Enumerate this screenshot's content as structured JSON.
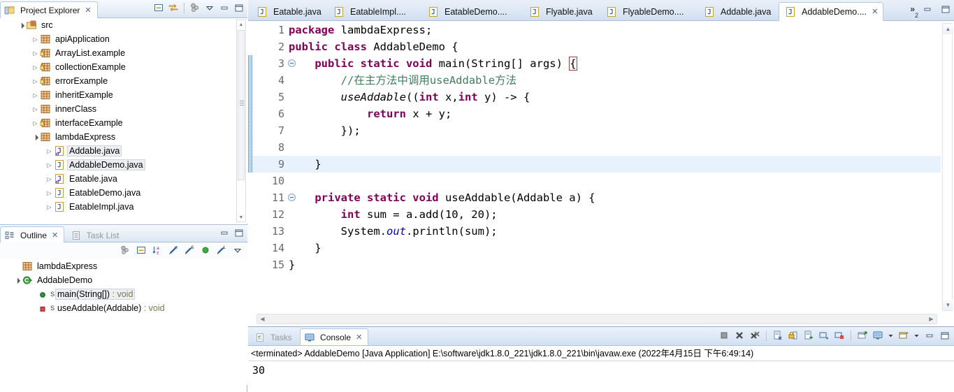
{
  "project_explorer": {
    "tab_label": "Project Explorer",
    "close_glyph": "✕",
    "toolbar": [
      {
        "name": "collapse-all-icon",
        "title": "Collapse All"
      },
      {
        "name": "link-with-editor-icon",
        "title": "Link with Editor"
      },
      {
        "name": "view-menu-spheres-icon",
        "title": "Focus on Active Task"
      },
      {
        "name": "view-menu-chevron-icon",
        "title": "View Menu"
      },
      {
        "name": "minimize-icon",
        "title": "Minimize"
      },
      {
        "name": "maximize-icon",
        "title": "Maximize"
      }
    ],
    "tree": [
      {
        "label": "src",
        "depth": 0,
        "icon": "source-folder-icon",
        "arrow": "down",
        "selected": false
      },
      {
        "label": "apiApplication",
        "depth": 1,
        "icon": "package-icon",
        "arrow": "right",
        "selected": false
      },
      {
        "label": "ArrayList.example",
        "depth": 1,
        "icon": "package-warn-icon",
        "arrow": "right",
        "selected": false
      },
      {
        "label": "collectionExample",
        "depth": 1,
        "icon": "package-warn-icon",
        "arrow": "right",
        "selected": false
      },
      {
        "label": "errorExample",
        "depth": 1,
        "icon": "package-warn-icon",
        "arrow": "right",
        "selected": false
      },
      {
        "label": "inheritExample",
        "depth": 1,
        "icon": "package-icon",
        "arrow": "right",
        "selected": false
      },
      {
        "label": "innerClass",
        "depth": 1,
        "icon": "package-icon",
        "arrow": "right",
        "selected": false
      },
      {
        "label": "interfaceExample",
        "depth": 1,
        "icon": "package-warn-icon",
        "arrow": "right",
        "selected": false
      },
      {
        "label": "lambdaExpress",
        "depth": 1,
        "icon": "package-icon",
        "arrow": "down",
        "selected": false
      },
      {
        "label": "Addable.java",
        "depth": 2,
        "icon": "java-interface-icon",
        "arrow": "right",
        "selected": true
      },
      {
        "label": "AddableDemo.java",
        "depth": 2,
        "icon": "java-class-icon",
        "arrow": "right",
        "selected": true
      },
      {
        "label": "Eatable.java",
        "depth": 2,
        "icon": "java-interface-icon",
        "arrow": "right",
        "selected": false
      },
      {
        "label": "EatableDemo.java",
        "depth": 2,
        "icon": "java-class-icon",
        "arrow": "right",
        "selected": false
      },
      {
        "label": "EatableImpl.java",
        "depth": 2,
        "icon": "java-class-icon",
        "arrow": "right",
        "selected": false
      }
    ]
  },
  "outline": {
    "tabs": [
      {
        "label": "Outline",
        "active": true,
        "icon": "outline-icon",
        "close_glyph": "✕"
      },
      {
        "label": "Task List",
        "active": false,
        "icon": "tasklist-icon"
      }
    ],
    "window_controls": [
      {
        "name": "minimize-icon"
      },
      {
        "name": "maximize-icon"
      }
    ],
    "toolbar": [
      {
        "name": "focus-spheres-icon"
      },
      {
        "name": "collapse-all-icon"
      },
      {
        "name": "sort-alphabetically-icon"
      },
      {
        "name": "hide-fields-icon"
      },
      {
        "name": "hide-static-members-icon"
      },
      {
        "name": "hide-non-public-icon"
      },
      {
        "name": "hide-local-types-icon"
      },
      {
        "name": "view-menu-chevron-icon"
      }
    ],
    "tree": [
      {
        "label": "lambdaExpress",
        "depth": 0,
        "icon": "package-icon",
        "arrow": "",
        "selected": false,
        "suffix": ""
      },
      {
        "label": "AddableDemo",
        "depth": 0,
        "icon": "class-icon",
        "arrow": "down",
        "selected": false,
        "suffix": ""
      },
      {
        "label": "main(String[])",
        "depth": 1,
        "icon": "public-method-icon",
        "badge": "S",
        "selected": true,
        "suffix": " : void"
      },
      {
        "label": "useAddable(Addable)",
        "depth": 1,
        "icon": "private-method-icon",
        "badge": "S",
        "selected": false,
        "suffix": " : void"
      }
    ]
  },
  "editor": {
    "tabs": [
      {
        "label": "Eatable.java",
        "active": false,
        "icon": "java-file-icon"
      },
      {
        "label": "EatableImpl....",
        "active": false,
        "icon": "java-file-icon"
      },
      {
        "label": "EatableDemo....",
        "active": false,
        "icon": "java-file-icon"
      },
      {
        "label": "Flyable.java",
        "active": false,
        "icon": "java-file-icon"
      },
      {
        "label": "FlyableDemo....",
        "active": false,
        "icon": "java-file-icon"
      },
      {
        "label": "Addable.java",
        "active": false,
        "icon": "java-file-icon"
      },
      {
        "label": "AddableDemo....",
        "active": true,
        "icon": "java-file-icon",
        "close_glyph": "✕"
      }
    ],
    "overflow": {
      "glyph": "»",
      "count": "2"
    },
    "window_controls": [
      {
        "name": "minimize-icon"
      },
      {
        "name": "maximize-icon"
      }
    ],
    "current_line": 9,
    "changed_line_range": [
      3,
      9
    ],
    "lines": [
      {
        "n": 1,
        "fold": false,
        "tokens": [
          {
            "t": "package ",
            "c": "kw"
          },
          {
            "t": "lambdaExpress;",
            "c": "plain"
          }
        ]
      },
      {
        "n": 2,
        "fold": false,
        "tokens": [
          {
            "t": "public class ",
            "c": "kw"
          },
          {
            "t": "AddableDemo {",
            "c": "plain"
          }
        ]
      },
      {
        "n": 3,
        "fold": true,
        "tokens": [
          {
            "t": "    ",
            "c": "plain"
          },
          {
            "t": "public static void ",
            "c": "kw"
          },
          {
            "t": "main(String[] args) ",
            "c": "plain"
          },
          {
            "t": "{",
            "c": "brk"
          }
        ]
      },
      {
        "n": 4,
        "fold": false,
        "tokens": [
          {
            "t": "        //在主方法中调用useAddable方法",
            "c": "cmt"
          }
        ]
      },
      {
        "n": 5,
        "fold": false,
        "tokens": [
          {
            "t": "        ",
            "c": "plain"
          },
          {
            "t": "useAddable",
            "c": "italic"
          },
          {
            "t": "((",
            "c": "plain"
          },
          {
            "t": "int ",
            "c": "kw"
          },
          {
            "t": "x,",
            "c": "plain"
          },
          {
            "t": "int ",
            "c": "kw"
          },
          {
            "t": "y) -> {",
            "c": "plain"
          }
        ]
      },
      {
        "n": 6,
        "fold": false,
        "tokens": [
          {
            "t": "            ",
            "c": "plain"
          },
          {
            "t": "return ",
            "c": "kw"
          },
          {
            "t": "x + y;",
            "c": "plain"
          }
        ]
      },
      {
        "n": 7,
        "fold": false,
        "tokens": [
          {
            "t": "        });",
            "c": "plain"
          }
        ]
      },
      {
        "n": 8,
        "fold": false,
        "tokens": [
          {
            "t": "",
            "c": "plain"
          }
        ]
      },
      {
        "n": 9,
        "fold": false,
        "tokens": [
          {
            "t": "    }",
            "c": "plain"
          }
        ]
      },
      {
        "n": 10,
        "fold": false,
        "tokens": [
          {
            "t": "",
            "c": "plain"
          }
        ]
      },
      {
        "n": 11,
        "fold": true,
        "tokens": [
          {
            "t": "    ",
            "c": "plain"
          },
          {
            "t": "private static void ",
            "c": "kw"
          },
          {
            "t": "useAddable(Addable a) {",
            "c": "plain"
          }
        ]
      },
      {
        "n": 12,
        "fold": false,
        "tokens": [
          {
            "t": "        ",
            "c": "plain"
          },
          {
            "t": "int ",
            "c": "kw"
          },
          {
            "t": "sum = a.add(10, 20);",
            "c": "plain"
          }
        ]
      },
      {
        "n": 13,
        "fold": false,
        "tokens": [
          {
            "t": "        System.",
            "c": "plain"
          },
          {
            "t": "out",
            "c": "fld"
          },
          {
            "t": ".println(sum);",
            "c": "plain"
          }
        ]
      },
      {
        "n": 14,
        "fold": false,
        "tokens": [
          {
            "t": "    }",
            "c": "plain"
          }
        ]
      },
      {
        "n": 15,
        "fold": false,
        "tokens": [
          {
            "t": "}",
            "c": "plain"
          }
        ]
      }
    ]
  },
  "console": {
    "tabs": [
      {
        "label": "Tasks",
        "active": false,
        "icon": "tasks-icon"
      },
      {
        "label": "Console",
        "active": true,
        "icon": "console-icon",
        "close_glyph": "✕"
      }
    ],
    "toolbar": [
      {
        "name": "terminate-icon"
      },
      {
        "name": "remove-launch-icon"
      },
      {
        "name": "remove-all-terminated-icon"
      },
      {
        "name": "clear-console-icon"
      },
      {
        "name": "scroll-lock-icon"
      },
      {
        "name": "word-wrap-icon"
      },
      {
        "name": "show-console-on-output-icon"
      },
      {
        "name": "show-console-on-error-icon"
      },
      {
        "name": "pin-console-icon"
      },
      {
        "name": "display-selected-console-icon"
      },
      {
        "name": "display-selected-console-dropdown-icon"
      },
      {
        "name": "open-console-icon"
      },
      {
        "name": "open-console-dropdown-icon"
      },
      {
        "name": "minimize-icon"
      },
      {
        "name": "maximize-icon"
      }
    ],
    "header": "<terminated> AddableDemo [Java Application] E:\\software\\jdk1.8.0_221\\jdk1.8.0_221\\bin\\javaw.exe (2022年4月15日 下午6:49:14)",
    "output": "30"
  },
  "colors": {
    "keyword": "#7f0055",
    "comment": "#3f7f5f",
    "field": "#0000c0",
    "selection": "#e8f2fe",
    "tab_active_bg": "#ffffff",
    "panel_border": "#a8c0dc"
  }
}
